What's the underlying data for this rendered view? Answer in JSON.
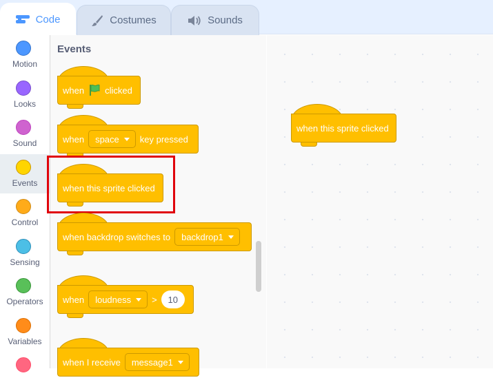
{
  "tabs": [
    {
      "label": "Code",
      "icon": "code-icon",
      "active": true
    },
    {
      "label": "Costumes",
      "icon": "brush-icon",
      "active": false
    },
    {
      "label": "Sounds",
      "icon": "speaker-icon",
      "active": false
    }
  ],
  "categories": [
    {
      "label": "Motion",
      "color": "#4c97ff"
    },
    {
      "label": "Looks",
      "color": "#9966ff"
    },
    {
      "label": "Sound",
      "color": "#cf63cf"
    },
    {
      "label": "Events",
      "color": "#ffd500",
      "active": true
    },
    {
      "label": "Control",
      "color": "#ffab19"
    },
    {
      "label": "Sensing",
      "color": "#4cbfe6"
    },
    {
      "label": "Operators",
      "color": "#59c059"
    },
    {
      "label": "Variables",
      "color": "#ff8c1a"
    },
    {
      "label": "",
      "color": "#ff6680"
    }
  ],
  "palette": {
    "title": "Events",
    "blocks": {
      "flag": {
        "when": "when",
        "clicked": "clicked",
        "icon": "green-flag-icon"
      },
      "key": {
        "when": "when",
        "key": "space",
        "pressed": "key pressed"
      },
      "sprite": {
        "text": "when this sprite clicked"
      },
      "backdrop": {
        "text": "when backdrop switches to",
        "value": "backdrop1"
      },
      "loudness": {
        "when": "when",
        "sensor": "loudness",
        "op": ">",
        "value": "10"
      },
      "receive": {
        "text": "when I receive",
        "value": "message1"
      }
    }
  },
  "workspace": {
    "block": {
      "text": "when this sprite clicked"
    }
  },
  "colors": {
    "events": "#ffbf00",
    "events_border": "#cc9900",
    "highlight": "#e0000a",
    "accent": "#4c97ff"
  }
}
